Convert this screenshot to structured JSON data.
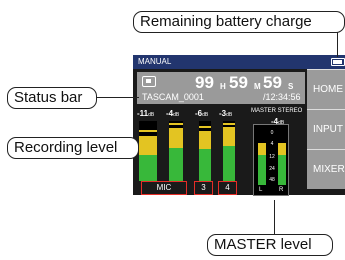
{
  "callouts": {
    "battery": "Remaining battery charge",
    "status_bar": "Status bar",
    "recording_level": "Recording level",
    "master_level": "MASTER level"
  },
  "screen": {
    "title": "MANUAL",
    "battery_level": 0.85,
    "status": {
      "hours": "99",
      "hours_unit": "H",
      "minutes": "59",
      "minutes_unit": "M",
      "seconds": "59",
      "seconds_unit": "S",
      "file_name": "TASCAM_0001",
      "elapsed": "/12:34:56"
    },
    "side_buttons": [
      "HOME",
      "INPUT",
      "MIXER"
    ],
    "channels": [
      {
        "db": "-11",
        "unit": "dB",
        "green": 0.52,
        "yellow": 0.78,
        "peak": 0.84
      },
      {
        "db": "-4",
        "unit": "dB",
        "green": 0.62,
        "yellow": 0.9,
        "peak": 0.94
      },
      {
        "db": "-6",
        "unit": "dB",
        "green": 0.6,
        "yellow": 0.86,
        "peak": 0.9
      },
      {
        "db": "-3",
        "unit": "dB",
        "green": 0.64,
        "yellow": 0.92,
        "peak": 0.95
      }
    ],
    "input_labels": [
      "MIC",
      "3",
      "4"
    ],
    "master": {
      "label": "MASTER STEREO",
      "db": "-4",
      "unit": "dB",
      "scale": [
        "0",
        "4",
        "12",
        "24",
        "48"
      ],
      "left_right": [
        "L",
        "R"
      ],
      "left": {
        "green": 0.55,
        "yellow": 0.78
      },
      "right": {
        "green": 0.55,
        "yellow": 0.78
      }
    }
  },
  "colors": {
    "title_bar": "#22356e",
    "meter_green": "#38b83a",
    "meter_yellow": "#e3c422",
    "input_border": "#e52d27"
  }
}
